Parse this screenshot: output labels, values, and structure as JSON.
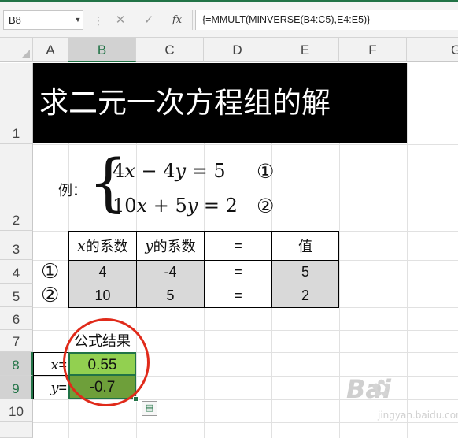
{
  "formula_bar": {
    "name_box": "B8",
    "cancel_icon": "✕",
    "enter_icon": "✓",
    "fx_label": "fx",
    "formula": "{=MMULT(MINVERSE(B4:C5),E4:E5)}"
  },
  "columns": [
    "A",
    "B",
    "C",
    "D",
    "E",
    "F",
    "G"
  ],
  "selected_column": "B",
  "rows": [
    "1",
    "2",
    "3",
    "4",
    "5",
    "6",
    "7",
    "8",
    "9",
    "10"
  ],
  "selected_rows": [
    "8",
    "9"
  ],
  "title": "求二元一次方程组的解",
  "example": {
    "label": "例：",
    "brace": "{",
    "eq1": {
      "c1": "4",
      "v1": "x",
      "op": " − 4",
      "v2": "y",
      "rhs": " = 5",
      "mark": "①"
    },
    "eq2": {
      "c1": "10",
      "v1": "x",
      "op": " + 5",
      "v2": "y",
      "rhs": " = 2",
      "mark": "②"
    }
  },
  "table": {
    "headers": [
      {
        "var": "x",
        "text": "的系数"
      },
      {
        "var": "y",
        "text": "的系数"
      },
      {
        "text": "="
      },
      {
        "text": "值"
      }
    ],
    "row_marks": [
      "①",
      "②"
    ],
    "rows": [
      [
        "4",
        "-4",
        "=",
        "5"
      ],
      [
        "10",
        "5",
        "=",
        "2"
      ]
    ]
  },
  "result": {
    "header": "公式结果",
    "x_label_var": "x",
    "y_label_var": "y",
    "eq_sign": "=",
    "x_value": "0.55",
    "y_value": "-0.7"
  },
  "watermark": {
    "text": "Bai",
    "paw": "✿",
    "sub": "jingyan.baidu.com"
  },
  "colors": {
    "excel_green": "#217346",
    "result_light": "#92d050",
    "result_dark": "#6e9f3a",
    "annotation_red": "#e02a1a",
    "gray_fill": "#d9d9d9"
  }
}
